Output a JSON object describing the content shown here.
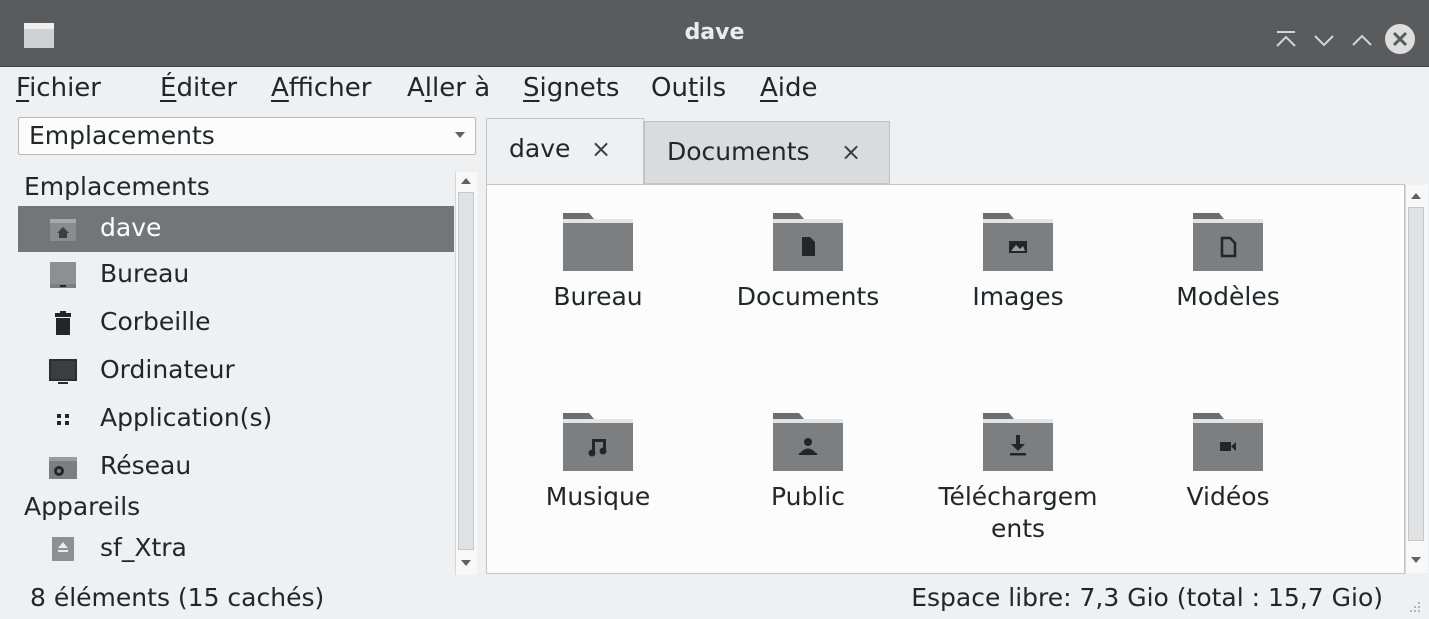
{
  "window": {
    "title": "dave",
    "controls": [
      "keep-above-icon",
      "minimize-icon",
      "maximize-icon",
      "close-icon"
    ]
  },
  "menubar": {
    "items": [
      {
        "mnemonic": "F",
        "rest": "ichier"
      },
      {
        "mnemonic": "É",
        "rest": "diter"
      },
      {
        "mnemonic": "A",
        "rest": "fficher"
      },
      {
        "pre": "A",
        "mnemonic": "l",
        "rest": "ler à"
      },
      {
        "mnemonic": "S",
        "rest": "ignets"
      },
      {
        "pre": "Ou",
        "mnemonic": "t",
        "rest": "ils"
      },
      {
        "mnemonic": "A",
        "rest": "ide"
      }
    ]
  },
  "sidebar": {
    "combo_value": "Emplacements",
    "sections": [
      {
        "header": "Emplacements",
        "items": [
          {
            "label": "dave",
            "icon": "home-folder-icon",
            "selected": true
          },
          {
            "label": "Bureau",
            "icon": "desktop-icon"
          },
          {
            "label": "Corbeille",
            "icon": "trash-icon"
          },
          {
            "label": "Ordinateur",
            "icon": "computer-icon"
          },
          {
            "label": "Application(s)",
            "icon": "applications-icon"
          },
          {
            "label": "Réseau",
            "icon": "network-folder-icon"
          }
        ]
      },
      {
        "header": "Appareils",
        "items": [
          {
            "label": "sf_Xtra",
            "icon": "drive-eject-icon"
          }
        ]
      }
    ]
  },
  "tabs": [
    {
      "label": "dave",
      "close": "×",
      "active": true
    },
    {
      "label": "Documents",
      "close": "×",
      "active": false
    }
  ],
  "files": [
    {
      "label": "Bureau",
      "icon": "folder-icon"
    },
    {
      "label": "Documents",
      "icon": "folder-documents-icon"
    },
    {
      "label": "Images",
      "icon": "folder-images-icon"
    },
    {
      "label": "Modèles",
      "icon": "folder-templates-icon"
    },
    {
      "label": "Musique",
      "icon": "folder-music-icon"
    },
    {
      "label": "Public",
      "icon": "folder-public-icon"
    },
    {
      "label": "Téléchargem\nents",
      "icon": "folder-downloads-icon"
    },
    {
      "label": "Vidéos",
      "icon": "folder-videos-icon"
    }
  ],
  "status": {
    "left": "8 éléments (15 cachés)",
    "right": "Espace libre: 7,3 Gio (total : 15,7 Gio)"
  },
  "colors": {
    "titlebar": "#5a5b5c",
    "selection": "#747577",
    "folder": "#7d7e7f",
    "folder_tab": "#6c6d6e",
    "close_button": "#dedede"
  }
}
